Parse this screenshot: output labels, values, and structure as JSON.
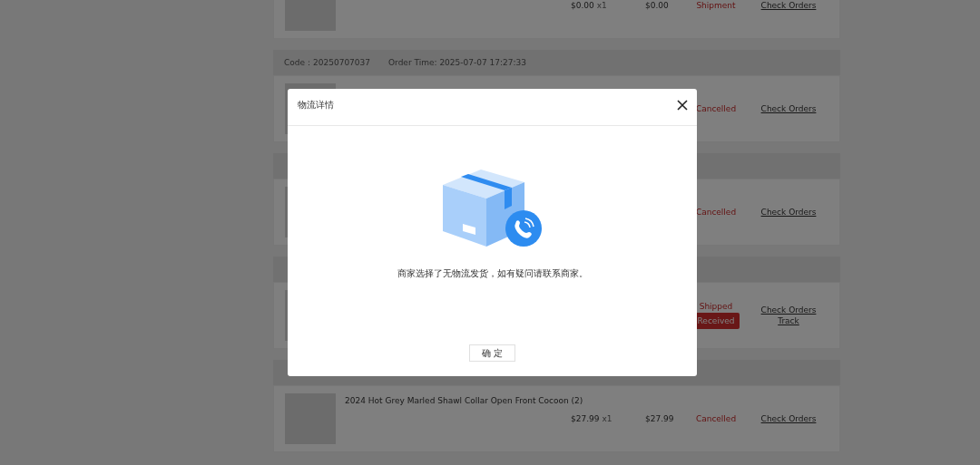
{
  "orders": [
    {
      "items": [
        {
          "price": "$0.00",
          "qty": "x1",
          "total": "$0.00"
        }
      ],
      "statuses": [
        {
          "kind": "text",
          "text": "Shipment"
        }
      ],
      "actions": [
        "Check Orders"
      ]
    },
    {
      "header": [
        "Code：20250707037",
        "Order Time: 2025-07-07 17:27:33"
      ],
      "statuses": [
        {
          "kind": "text",
          "text": "Cancelled"
        }
      ],
      "actions": [
        "Check Orders"
      ]
    },
    {
      "statuses": [
        {
          "kind": "text",
          "text": "Cancelled"
        }
      ],
      "actions": [
        "Check Orders"
      ]
    },
    {
      "statuses": [
        {
          "kind": "text",
          "text": "Shipped"
        },
        {
          "kind": "button",
          "text": "Received"
        }
      ],
      "actions": [
        "Check Orders",
        "Track"
      ]
    },
    {
      "items": [
        {
          "title": "2024 Hot Grey Marled Shawl Collar Open Front Cocoon (2)",
          "price": "$27.99",
          "qty": "x1",
          "total": "$27.99"
        }
      ],
      "statuses": [
        {
          "kind": "text",
          "text": "Cancelled"
        }
      ],
      "actions": [
        "Check Orders"
      ]
    }
  ],
  "dialog": {
    "title": "物流详情",
    "message": "商家选择了无物流发货，如有疑问请联系商家。",
    "confirm": "确 定"
  }
}
